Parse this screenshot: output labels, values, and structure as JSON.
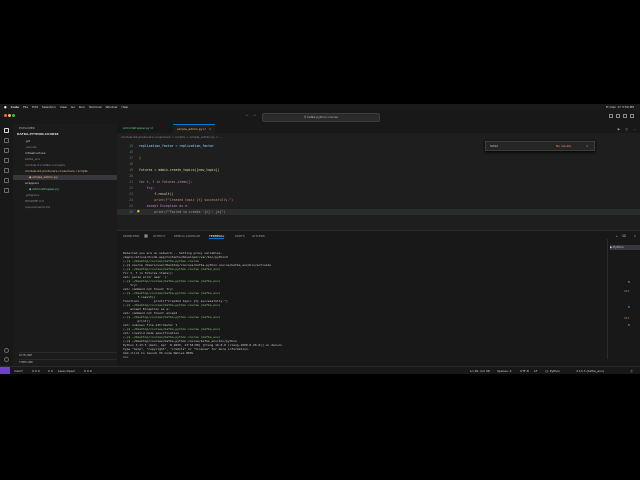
{
  "menubar": {
    "items": [
      "Code",
      "File",
      "Edit",
      "Selection",
      "View",
      "Go",
      "Run",
      "Terminal",
      "Window",
      "Help"
    ],
    "clock": "Fri Dec 17 3:59 PM"
  },
  "titlebar": {
    "search": "kafka-python-course"
  },
  "sidebar": {
    "header": "EXPLORER",
    "project": "KAFKA-PYTHON-COURSE",
    "items": [
      {
        "label": ".git",
        "color": "#cccccc"
      },
      {
        "label": ".vscode",
        "color": "#8a8a8a"
      },
      {
        "label": "infrastructure",
        "color": "#cccccc"
      },
      {
        "label": "kafka_env",
        "color": "#8a8a8a"
      },
      {
        "label": "module-01-kafka-concepts",
        "color": "#8a8a8a"
      },
      {
        "label": "module-02-producers-consumers / scripts",
        "color": "#e2c08d"
      },
      {
        "label": "simple_admin.py",
        "color": "#e2c08d"
      },
      {
        "label": "wrappers",
        "color": "#cccccc"
      },
      {
        "label": "AdminWrapper.py",
        "color": "#73c991"
      },
      {
        "label": ".gitignore",
        "color": "#8a8a8a"
      },
      {
        "label": "README.md",
        "color": "#8a8a8a"
      },
      {
        "label": "requirements.txt",
        "color": "#8a8a8a"
      }
    ],
    "outline": "OUTLINE",
    "timeline": "TIMELINE"
  },
  "editor": {
    "tabs": [
      {
        "label": "AdminWrapper.py U",
        "active": false
      },
      {
        "label": "simple_admin.py U",
        "active": true
      }
    ],
    "breadcrumb": "module-02-producers-consumers > scripts > simple_admin.py > ...",
    "find": {
      "query": "SOS2",
      "result": "No results"
    },
    "lines": [
      {
        "n": "15",
        "text": "replication_factor = replication_factor"
      },
      {
        "n": "16",
        "text": ""
      },
      {
        "n": "17",
        "text": ")"
      },
      {
        "n": "18",
        "text": ""
      },
      {
        "n": "19",
        "text": "futures = admin.create_topics([new_topic])"
      },
      {
        "n": "20",
        "text": ""
      },
      {
        "n": "21",
        "text": "for t, f in futures.items():"
      },
      {
        "n": "22",
        "text": "    try:"
      },
      {
        "n": "23",
        "text": "        f.result()"
      },
      {
        "n": "24",
        "text": "        print(f\"Created topic {t} successfully.\")"
      },
      {
        "n": "25",
        "text": "    except Exception as e:"
      },
      {
        "n": "26",
        "text": "        print(f\"Failed to create '{t}': {e}\")"
      }
    ]
  },
  "panel": {
    "tabs": [
      "PROBLEMS",
      "OUTPUT",
      "DEBUG CONSOLE",
      "TERMINAL",
      "PORTS",
      "GITLENS"
    ],
    "problems_count": "1",
    "terminal_lines": [
      "Detected you are on network... Setting proxy variables.",
      "/Applications/Xcode.app/Contents/Developer/usr/bin/python3",
      "(~)$ ~/Desktop/courses/kafka-python-course",
      "(~)$ source /Users/user/Desktop/courses/kafka-python-course/kafka_env/bin/activate",
      "(~)$ ~/Desktop/courses/kafka-python-course (kafka_env)",
      "for t, f in futures.items():",
      "zsh: parse error near `)'",
      "(~)$ ~/Desktop/courses/kafka-python-course (kafka_env)",
      "    try:",
      "zsh: command not found: try:",
      "(~)$ ~/Desktop/courses/kafka-python-course (kafka_env)",
      "        f.result()",
      "function>        print(f\"Created topic {t} successfully.\")",
      "(~)$ ~/Desktop/courses/kafka-python-course (kafka_env)",
      "    except Exception as e:",
      "zsh: command not found: except",
      "(~)$ ~/Desktop/courses/kafka-python-course (kafka_env)",
      "        print()",
      "zsh: unknown file attribute: t",
      "(~)$ ~/Desktop/courses/kafka-python-course (kafka_env)",
      "zsh: invalid mode specification",
      "(~)$ ~/Desktop/courses/kafka-python-course (kafka_env)",
      "(~)$ ~/Desktop/courses/kafka-python-course/kafka_env/bin/python",
      "Python 3.13.3 (main, Apr  8 2025, 13:54:08) [Clang 16.0.0 (clang-1600.0.26.6)] on darwin",
      "Type \"help\", \"copyright\", \"credits\" or \"license\" for more information.",
      "Cmd click to launch VS Code Native REPL",
      ">>> "
    ],
    "right_markers": [
      "5",
      "117",
      "5",
      "117",
      "5"
    ]
  },
  "statusbar": {
    "left": [
      "main*",
      "0 0 0",
      "0 0",
      "Launchpad",
      "0 0 0"
    ],
    "right": [
      "Ln 26, Col 58",
      "Spaces: 4",
      "UTF-8",
      "LF",
      "{} Python",
      "3.13.3 (kafka_env)"
    ]
  }
}
